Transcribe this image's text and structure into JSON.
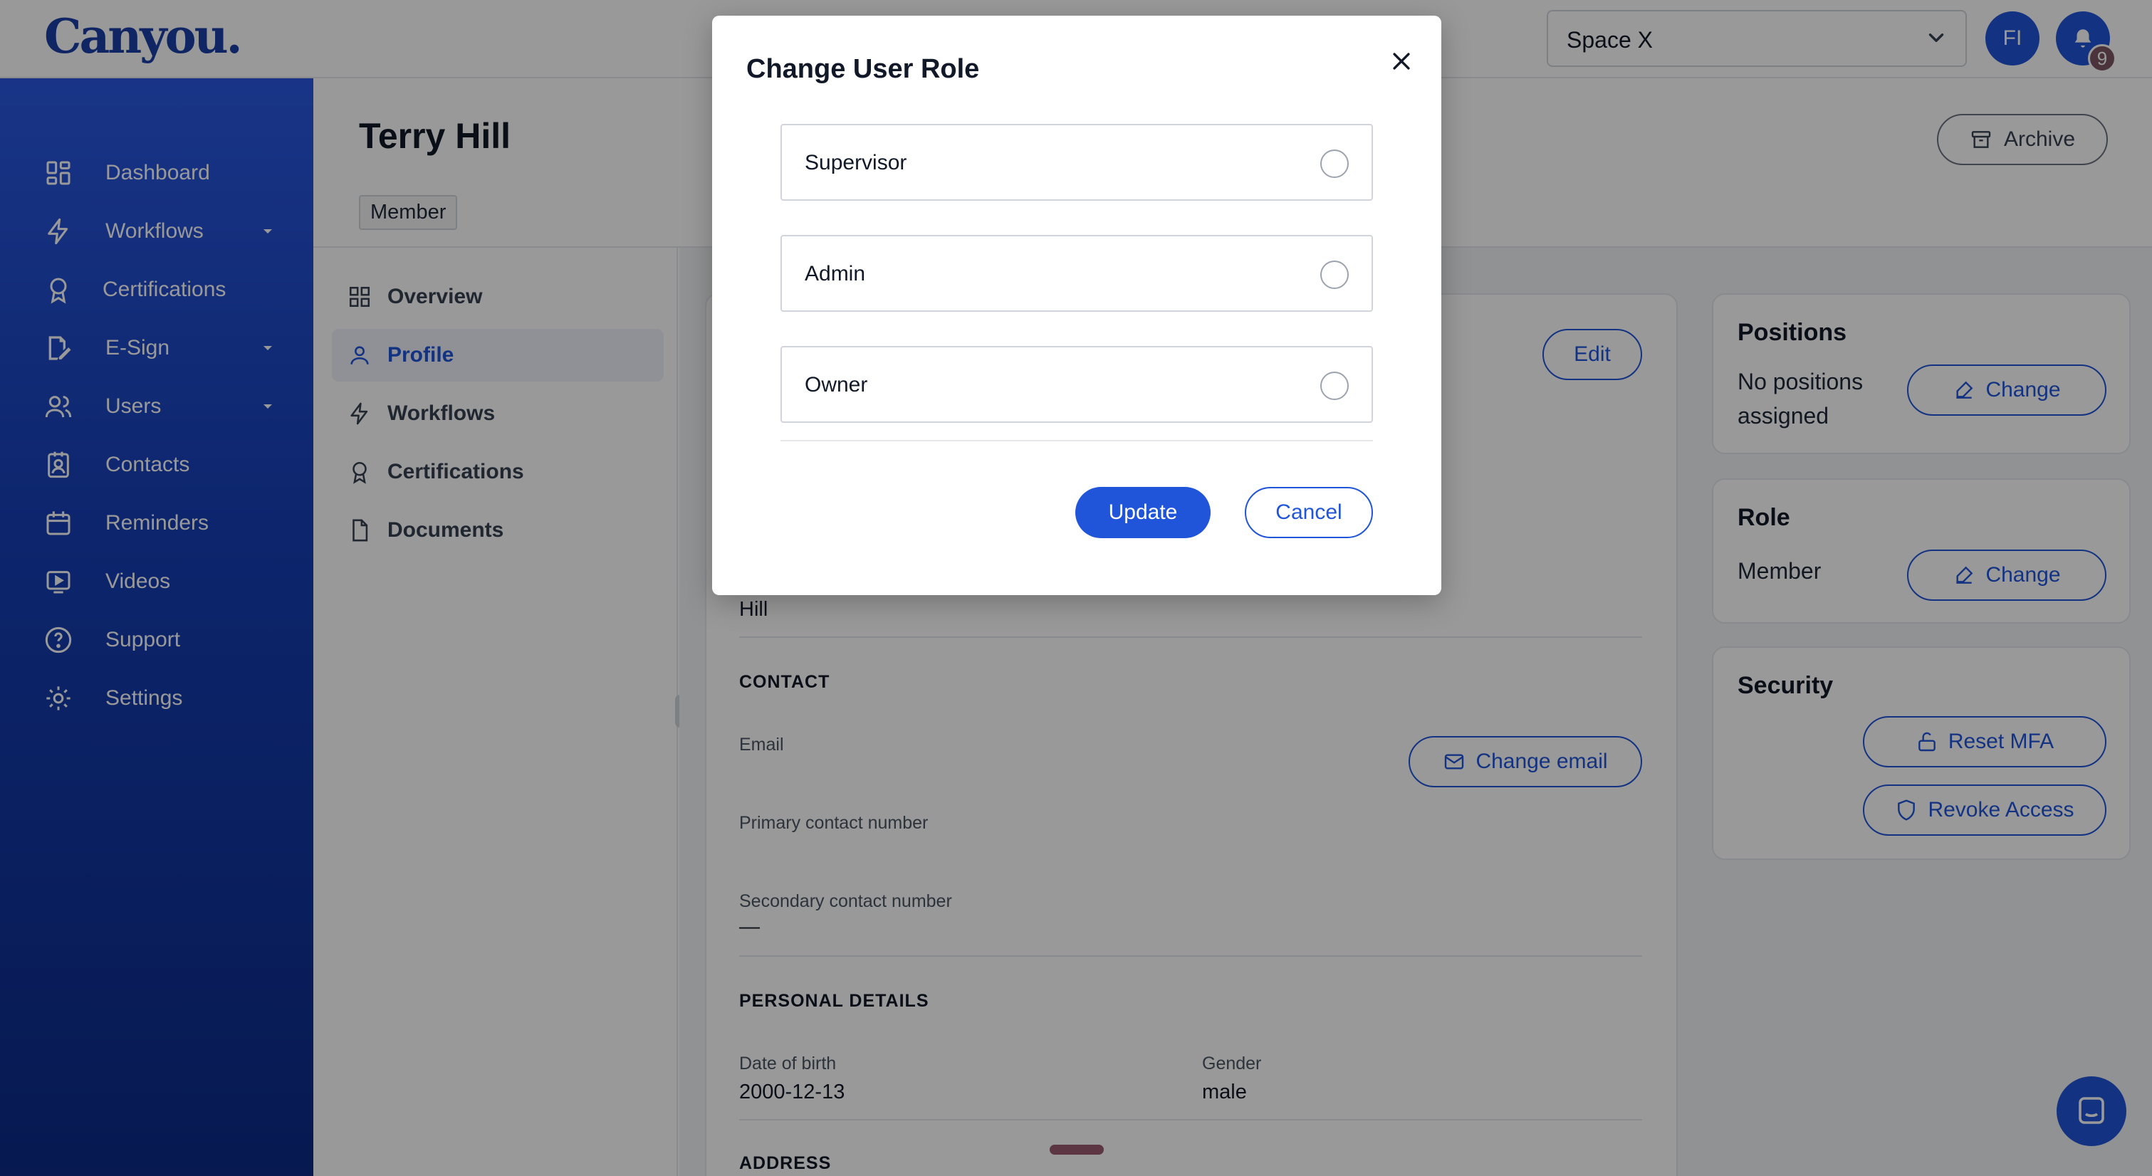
{
  "header": {
    "logo": "Canyou.",
    "space_value": "Space X",
    "avatar_initials": "FI",
    "notification_count": "9"
  },
  "sidebar": {
    "items": [
      {
        "label": "Dashboard",
        "icon": "grid-icon"
      },
      {
        "label": "Workflows",
        "icon": "bolt-icon",
        "has_caret": true
      },
      {
        "label": "Certifications",
        "icon": "award-icon"
      },
      {
        "label": "E-Sign",
        "icon": "signature-icon",
        "has_caret": true
      },
      {
        "label": "Users",
        "icon": "users-icon",
        "has_caret": true
      },
      {
        "label": "Contacts",
        "icon": "contact-icon"
      },
      {
        "label": "Reminders",
        "icon": "calendar-icon"
      },
      {
        "label": "Videos",
        "icon": "video-icon"
      },
      {
        "label": "Support",
        "icon": "help-icon"
      },
      {
        "label": "Settings",
        "icon": "gear-icon"
      }
    ]
  },
  "user": {
    "name": "Terry Hill",
    "role_chip": "Member",
    "archive_label": "Archive"
  },
  "subnav": {
    "items": [
      {
        "label": "Overview",
        "icon": "grid-icon"
      },
      {
        "label": "Profile",
        "icon": "user-icon",
        "active": true
      },
      {
        "label": "Workflows",
        "icon": "bolt-icon"
      },
      {
        "label": "Certifications",
        "icon": "award-icon"
      },
      {
        "label": "Documents",
        "icon": "document-icon"
      }
    ]
  },
  "profile": {
    "edit_label": "Edit",
    "last_name_value": "Hill",
    "contact_heading": "CONTACT",
    "email_label": "Email",
    "change_email_label": "Change email",
    "primary_contact_label": "Primary contact number",
    "secondary_contact_label": "Secondary contact number",
    "secondary_contact_value": "—",
    "personal_heading": "PERSONAL DETAILS",
    "dob_label": "Date of birth",
    "dob_value": "2000-12-13",
    "gender_label": "Gender",
    "gender_value": "male",
    "address_heading": "ADDRESS"
  },
  "positions_card": {
    "title": "Positions",
    "text": "No positions assigned",
    "change_label": "Change"
  },
  "role_card": {
    "title": "Role",
    "value": "Member",
    "change_label": "Change"
  },
  "security_card": {
    "title": "Security",
    "reset_mfa_label": "Reset MFA",
    "revoke_access_label": "Revoke Access"
  },
  "modal": {
    "title": "Change User Role",
    "options": [
      "Supervisor",
      "Admin",
      "Owner"
    ],
    "update_label": "Update",
    "cancel_label": "Cancel"
  },
  "colors": {
    "brand": "#2155d9",
    "sidebar_top": "#2a58e0",
    "sidebar_bottom": "#0c2a86",
    "badge": "#7d5563"
  }
}
